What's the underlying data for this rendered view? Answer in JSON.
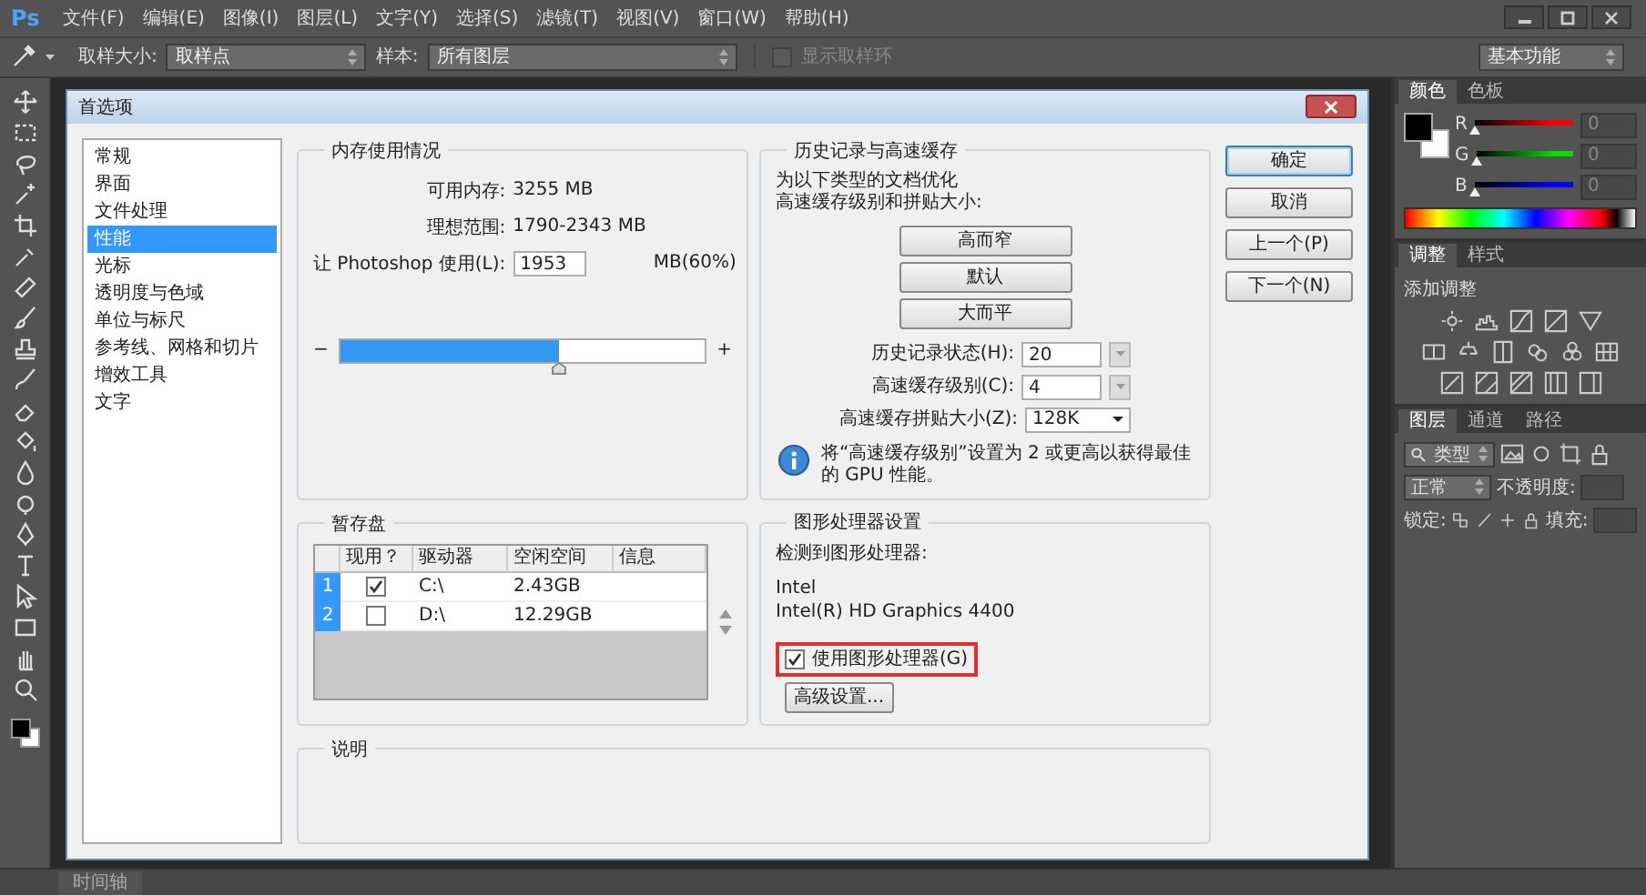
{
  "app": {
    "logo": "Ps"
  },
  "menu": [
    "文件(F)",
    "编辑(E)",
    "图像(I)",
    "图层(L)",
    "文字(Y)",
    "选择(S)",
    "滤镜(T)",
    "视图(V)",
    "窗口(W)",
    "帮助(H)"
  ],
  "options_bar": {
    "sample_size_label": "取样大小:",
    "sample_size": "取样点",
    "sample_label": "样本:",
    "sample": "所有图层",
    "show_ring": {
      "label": "显示取样环",
      "checked": false,
      "disabled": true
    },
    "workspace": "基本功能"
  },
  "dialog": {
    "title": "首选项",
    "categories": [
      {
        "label": "常规",
        "selected": false
      },
      {
        "label": "界面",
        "selected": false
      },
      {
        "label": "文件处理",
        "selected": false
      },
      {
        "label": "性能",
        "selected": true
      },
      {
        "label": "光标",
        "selected": false
      },
      {
        "label": "透明度与色域",
        "selected": false
      },
      {
        "label": "单位与标尺",
        "selected": false
      },
      {
        "label": "参考线、网格和切片",
        "selected": false
      },
      {
        "label": "增效工具",
        "selected": false
      },
      {
        "label": "文字",
        "selected": false
      }
    ],
    "memory": {
      "title": "内存使用情况",
      "available_label": "可用内存:",
      "available": "3255 MB",
      "ideal_label": "理想范围:",
      "ideal": "1790-2343 MB",
      "use_label": "让 Photoshop 使用(L):",
      "use_value": "1953",
      "use_unit": "MB(60%)",
      "minus": "−",
      "plus": "+",
      "level": 0.6
    },
    "history": {
      "title": "历史记录与高速缓存",
      "hint": [
        "为以下类型的文档优化",
        "高速缓存级别和拼贴大小:"
      ],
      "presets": [
        "高而窄",
        "默认",
        "大而平"
      ],
      "fields": [
        {
          "label": "历史记录状态(H):",
          "value": "20",
          "kind": "spin"
        },
        {
          "label": "高速缓存级别(C):",
          "value": "4",
          "kind": "spin"
        },
        {
          "label": "高速缓存拼贴大小(Z):",
          "value": "128K",
          "kind": "dropdown"
        }
      ],
      "info": "将“高速缓存级别”设置为 2 或更高以获得最佳的 GPU 性能。"
    },
    "buttons": [
      {
        "label": "确定",
        "default": true
      },
      {
        "label": "取消",
        "default": false
      },
      {
        "label": "上一个(P)",
        "default": false
      },
      {
        "label": "下一个(N)",
        "default": false
      }
    ],
    "scratch": {
      "title": "暂存盘",
      "columns": [
        "现用？",
        "驱动器",
        "空闲空间",
        "信息"
      ],
      "rows": [
        {
          "index": "1",
          "active": true,
          "drive": "C:\\",
          "free": "2.43GB"
        },
        {
          "index": "2",
          "active": false,
          "drive": "D:\\",
          "free": "12.29GB"
        }
      ]
    },
    "gpu": {
      "title": "图形处理器设置",
      "detected_label": "检测到图形处理器:",
      "vendor": "Intel",
      "model": "Intel(R) HD Graphics 4400",
      "use_gpu": {
        "label": "使用图形处理器(G)",
        "checked": true,
        "highlighted": true
      },
      "advanced": "高级设置..."
    },
    "description": {
      "title": "说明"
    }
  },
  "panels": {
    "color": {
      "tabs": [
        {
          "label": "颜色",
          "selected": true
        },
        {
          "label": "色板",
          "selected": false
        }
      ],
      "channels": [
        {
          "name": "R",
          "color": "#ff0000",
          "level": 0,
          "value": "0"
        },
        {
          "name": "G",
          "color": "#00dd00",
          "level": 0,
          "value": "0"
        },
        {
          "name": "B",
          "color": "#0000ff",
          "level": 0,
          "value": "0"
        }
      ]
    },
    "adjustments": {
      "tabs": [
        {
          "label": "调整",
          "selected": true
        },
        {
          "label": "样式",
          "selected": false
        }
      ],
      "heading": "添加调整"
    },
    "layers": {
      "tabs": [
        {
          "label": "图层",
          "selected": true
        },
        {
          "label": "通道",
          "selected": false
        },
        {
          "label": "路径",
          "selected": false
        }
      ],
      "filter": "类型",
      "blend_mode": "正常",
      "opacity_label": "不透明度:",
      "lock_label": "锁定:",
      "fill_label": "填充:"
    }
  },
  "status_bar": {
    "tab": "时间轴"
  }
}
